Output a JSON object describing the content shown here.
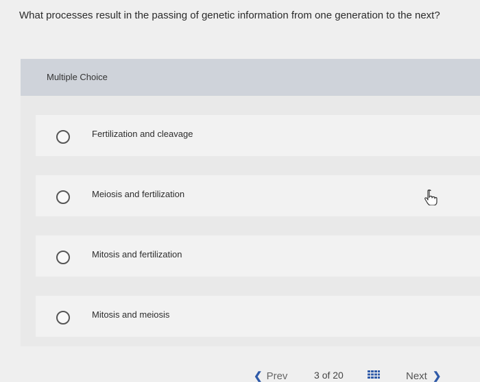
{
  "question": {
    "text": "What processes result in the passing of genetic information from one generation to the next?"
  },
  "section": {
    "label": "Multiple Choice"
  },
  "options": [
    {
      "label": "Fertilization and cleavage"
    },
    {
      "label": "Meiosis and fertilization"
    },
    {
      "label": "Mitosis and fertilization"
    },
    {
      "label": "Mitosis and meiosis"
    }
  ],
  "footer": {
    "prev_label": "Prev",
    "page_current": "3",
    "page_of": "of",
    "page_total": "20",
    "next_label": "Next"
  },
  "icons": {
    "radio": "radio-button-icon",
    "cursor": "hand-pointer-icon",
    "grid": "grid-icon",
    "prev": "chevron-left-icon",
    "next": "chevron-right-icon"
  },
  "colors": {
    "accent": "#2f5aa8",
    "header_bg": "#cfd3da",
    "page_bg": "#efefef"
  }
}
